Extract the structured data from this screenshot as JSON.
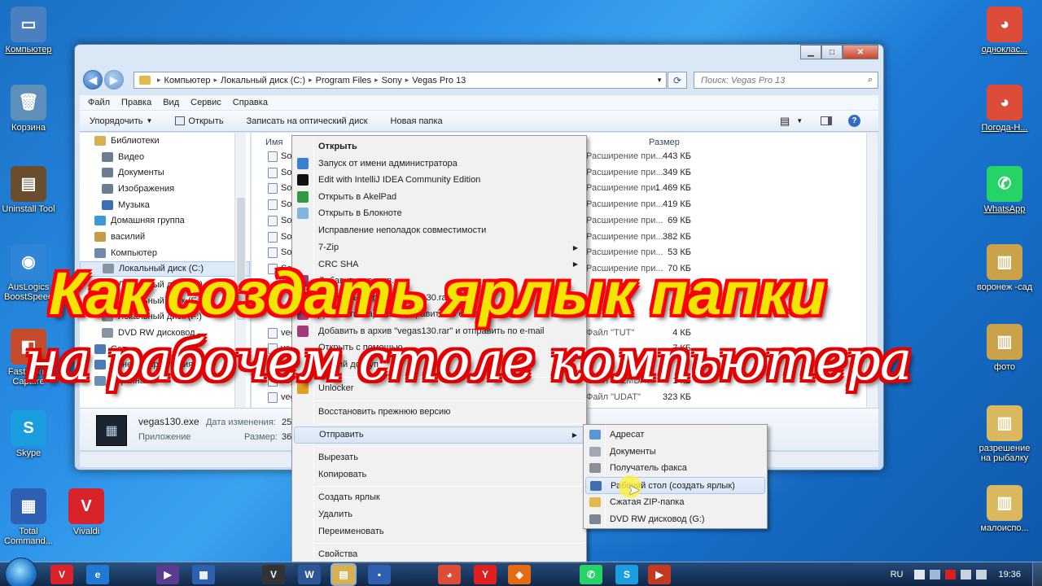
{
  "desktop_left": [
    {
      "label": "Компьютер",
      "glyph": "▭",
      "color": "#4a7fc0"
    },
    {
      "label": "Корзина",
      "glyph": "🗑",
      "color": "#5d8fb8"
    },
    {
      "label": "Uninstall Tool",
      "glyph": "▤",
      "color": "#6a4d2d"
    },
    {
      "label": "AusLogics BoostSpeed",
      "glyph": "◉",
      "color": "#2f86d6"
    },
    {
      "label": "FastStone Capture",
      "glyph": "◧",
      "color": "#c64b2d"
    },
    {
      "label": "Skype",
      "glyph": "S",
      "color": "#1a9ee0"
    },
    {
      "label": "Total Command...",
      "glyph": "▦",
      "color": "#2f5fb0"
    }
  ],
  "desktop_vivaldi": {
    "label": "Vivaldi",
    "glyph": "V",
    "color": "#d8232a"
  },
  "desktop_right": [
    {
      "label": "однoклас...",
      "glyph": "◕",
      "color": "#dd4b39"
    },
    {
      "label": "Погода-Н...",
      "glyph": "◕",
      "color": "#dd4b39"
    },
    {
      "label": "WhatsApp",
      "glyph": "✆",
      "color": "#25d366"
    },
    {
      "label": "воронеж -сад",
      "glyph": "▥",
      "color": "#c9a24a"
    },
    {
      "label": "фото",
      "glyph": "▥",
      "color": "#c9a24a"
    },
    {
      "label": "разрешение на рыбалку",
      "glyph": "▥",
      "color": "#d9b860"
    },
    {
      "label": "малоиспо...",
      "glyph": "▥",
      "color": "#d9b860"
    }
  ],
  "window": {
    "address": [
      "Компьютер",
      "Локальный диск (C:)",
      "Program Files",
      "Sony",
      "Vegas Pro 13"
    ],
    "search_placeholder": "Поиск: Vegas Pro 13",
    "menu": [
      "Файл",
      "Правка",
      "Вид",
      "Сервис",
      "Справка"
    ],
    "toolbar": {
      "organize": "Упорядочить",
      "open": "Открыть",
      "burn": "Записать на оптический диск",
      "new_folder": "Новая папка"
    },
    "nav": [
      {
        "label": "Библиотеки",
        "indent": 0,
        "color": "#d9b051"
      },
      {
        "label": "Видео",
        "indent": 1,
        "color": "#6b7d91"
      },
      {
        "label": "Документы",
        "indent": 1,
        "color": "#6b7d91"
      },
      {
        "label": "Изображения",
        "indent": 1,
        "color": "#6b7d91"
      },
      {
        "label": "Музыка",
        "indent": 1,
        "color": "#3f6fb3"
      },
      {
        "label": "Домашняя группа",
        "indent": 0,
        "color": "#3a9bd6"
      },
      {
        "label": "василий",
        "indent": 0,
        "color": "#c79b46"
      },
      {
        "label": "Компьютер",
        "indent": 0,
        "color": "#6f89a7"
      },
      {
        "label": "Локальный диск (C:)",
        "indent": 1,
        "color": "#8894a3",
        "selected": true
      },
      {
        "label": "Локальный диск (D:)",
        "indent": 1,
        "color": "#8894a3"
      },
      {
        "label": "Локальный диск (E:)",
        "indent": 1,
        "color": "#8894a3"
      },
      {
        "label": "Локальный диск (F:)",
        "indent": 1,
        "color": "#8894a3"
      },
      {
        "label": "DVD RW дисковод",
        "indent": 1,
        "color": "#8894a3"
      },
      {
        "label": "Сеть",
        "indent": 0,
        "color": "#4b7bb7"
      },
      {
        "label": "Панель управления",
        "indent": 0,
        "color": "#4b7bb7"
      },
      {
        "label": "Корзина",
        "indent": 0,
        "color": "#6b8eb5"
      }
    ],
    "columns": {
      "name": "Имя",
      "size": "Размер"
    },
    "files": [
      {
        "name": "So",
        "type": "Расширение при...",
        "size": "443 КБ"
      },
      {
        "name": "So",
        "type": "Расширение при...",
        "size": "349 КБ"
      },
      {
        "name": "So",
        "type": "Расширение при...",
        "size": "1 469 КБ"
      },
      {
        "name": "So",
        "type": "Расширение при...",
        "size": "419 КБ"
      },
      {
        "name": "So",
        "type": "Расширение при...",
        "size": "69 КБ"
      },
      {
        "name": "So",
        "type": "Расширение при...",
        "size": "382 КБ"
      },
      {
        "name": "So",
        "type": "Расширение при...",
        "size": "53 КБ"
      },
      {
        "name": "So",
        "type": "Расширение при...",
        "size": "70 КБ"
      },
      {
        "name": "",
        "type": "",
        "size": ""
      },
      {
        "name": "",
        "type": "",
        "size": ""
      },
      {
        "name": "",
        "type": "",
        "size": ""
      },
      {
        "name": "veg",
        "type": "Файл \"TUT\"",
        "size": "4 КБ"
      },
      {
        "name": "veg",
        "type": "",
        "size": "7 КБ"
      },
      {
        "name": "veg",
        "type": "",
        "size": ""
      },
      {
        "name": "veg",
        "type": "Файл \"DEMDAT\"",
        "size": "1 КБ"
      },
      {
        "name": "veg",
        "type": "Файл \"UDAT\"",
        "size": "323 КБ"
      }
    ],
    "details": {
      "filename": "vegas130.exe",
      "date_label": "Дата изменения:",
      "date_value": "25.1",
      "kind": "Приложение",
      "size_label": "Размер:",
      "size_value": "36,4"
    }
  },
  "context_menu": [
    {
      "label": "Открыть",
      "bold": true,
      "icon": "",
      "icolor": ""
    },
    {
      "label": "Запуск от имени администратора",
      "icon": "shield",
      "icolor": "#3b7fd0"
    },
    {
      "label": "Edit with IntelliJ IDEA Community Edition",
      "icon": "ij",
      "icolor": "#111"
    },
    {
      "label": "Открыть в AkelPad",
      "icon": "ak",
      "icolor": "#2f9a3f"
    },
    {
      "label": "Открыть в Блокноте",
      "icon": "np",
      "icolor": "#7fb5df"
    },
    {
      "label": "Исправление неполадок совместимости",
      "icon": "",
      "icolor": ""
    },
    {
      "label": "7-Zip",
      "icon": "",
      "icolor": "",
      "submenu": true
    },
    {
      "label": "CRC SHA",
      "icon": "",
      "icolor": "",
      "submenu": true
    },
    {
      "label": "Добавить в архив...",
      "icon": "rar",
      "icolor": "#a33a7a"
    },
    {
      "label": "Добавить в архив \"vegas130.rar\"",
      "icon": "rar",
      "icolor": "#a33a7a"
    },
    {
      "label": "Добавить в архив и отправить по e-mail",
      "icon": "rar",
      "icolor": "#a33a7a"
    },
    {
      "label": "Добавить в архив \"vegas130.rar\" и отправить по e-mail",
      "icon": "rar",
      "icolor": "#a33a7a"
    },
    {
      "label": "Открыть с помощью",
      "icon": "",
      "icolor": ""
    },
    {
      "label": "Общий доступ",
      "icon": "",
      "icolor": ""
    },
    {
      "label": "Unlocker",
      "icon": "wand",
      "icolor": "#e0a020"
    },
    {
      "label": "Восстановить прежнюю версию",
      "icon": "",
      "icolor": ""
    },
    {
      "label": "Отправить",
      "icon": "",
      "icolor": "",
      "submenu": true,
      "highlight": true
    },
    {
      "label": "Вырезать",
      "icon": "",
      "icolor": ""
    },
    {
      "label": "Копировать",
      "icon": "",
      "icolor": ""
    },
    {
      "label": "Создать ярлык",
      "icon": "",
      "icolor": ""
    },
    {
      "label": "Удалить",
      "icon": "",
      "icolor": ""
    },
    {
      "label": "Переименовать",
      "icon": "",
      "icolor": ""
    },
    {
      "label": "Свойства",
      "icon": "",
      "icolor": ""
    }
  ],
  "sendto_menu": [
    {
      "label": "Адресат",
      "color": "#5a96d6"
    },
    {
      "label": "Документы",
      "color": "#a0a8b4"
    },
    {
      "label": "Получатель факса",
      "color": "#8a8f98"
    },
    {
      "label": "Рабочий стол (создать ярлык)",
      "color": "#3f6fb3",
      "highlight": true
    },
    {
      "label": "Сжатая ZIP-папка",
      "color": "#e2b94a"
    },
    {
      "label": "DVD RW дисковод (G:)",
      "color": "#7c8593"
    }
  ],
  "overlay": {
    "line1": "Как создать ярлык папки",
    "line2": "на рабочем столе компьютера"
  },
  "taskbar": {
    "lang": "RU",
    "time": "19:36",
    "apps": [
      {
        "glyph": "V",
        "color": "#d8232a"
      },
      {
        "glyph": "e",
        "color": "#1f7ad6"
      },
      {
        "glyph": "▶",
        "color": "#5a3b8f"
      },
      {
        "glyph": "▦",
        "color": "#2f5fb0"
      },
      {
        "glyph": "V",
        "color": "#333"
      },
      {
        "glyph": "W",
        "color": "#2b5797"
      },
      {
        "glyph": "▤",
        "color": "#d9b051"
      },
      {
        "glyph": "▪",
        "color": "#2f5fb0"
      },
      {
        "glyph": "◕",
        "color": "#dd4b39"
      },
      {
        "glyph": "Y",
        "color": "#e0201f"
      },
      {
        "glyph": "◈",
        "color": "#e46b12"
      },
      {
        "glyph": "✆",
        "color": "#25d366"
      },
      {
        "glyph": "S",
        "color": "#1a9ee0"
      },
      {
        "glyph": "▶",
        "color": "#c43a1e"
      }
    ]
  }
}
